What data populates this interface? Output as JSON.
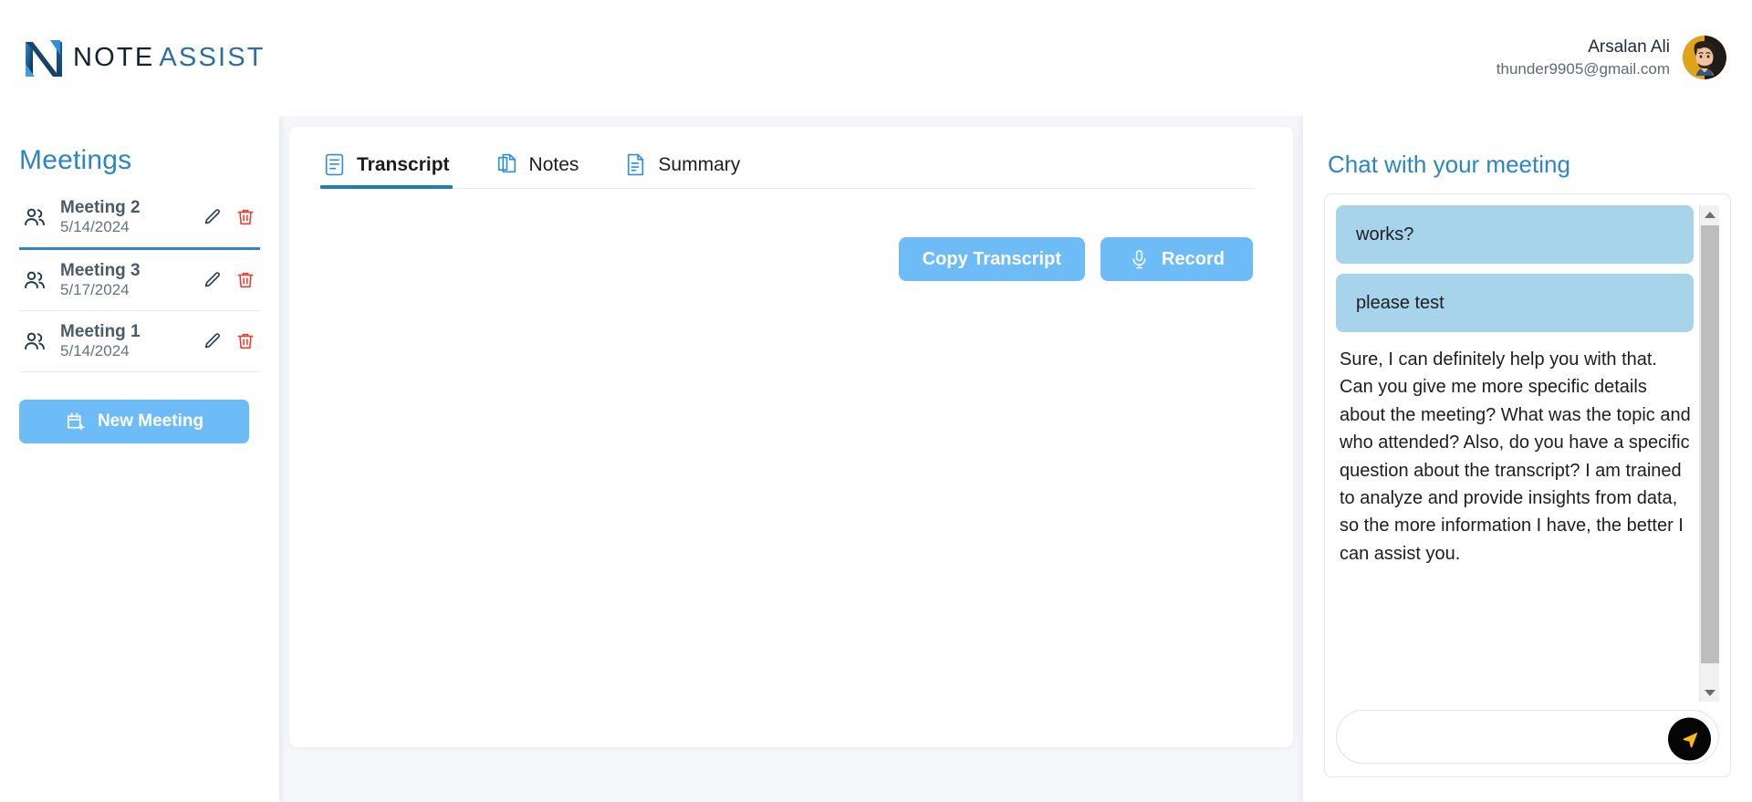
{
  "brand": {
    "name_part1": "NOTE",
    "name_part2": "ASSIST",
    "logo_icon": "n-monogram-icon",
    "accent_blue": "#2b86c4",
    "button_blue": "#6ebcf7",
    "bubble_blue": "#a7d4ea",
    "danger_red": "#ef3b2d",
    "send_yellow": "#fcb813"
  },
  "header": {
    "user_name": "Arsalan Ali",
    "user_email": "thunder9905@gmail.com",
    "avatar_icon": "user-avatar"
  },
  "sidebar": {
    "title": "Meetings",
    "meetings": [
      {
        "name": "Meeting 2",
        "date": "5/14/2024",
        "active": true
      },
      {
        "name": "Meeting 3",
        "date": "5/17/2024",
        "active": false
      },
      {
        "name": "Meeting 1",
        "date": "5/14/2024",
        "active": false
      }
    ],
    "new_meeting_label": "New Meeting"
  },
  "main": {
    "tabs": [
      {
        "label": "Transcript",
        "icon": "transcript-document-icon",
        "active": true
      },
      {
        "label": "Notes",
        "icon": "copy-pages-icon",
        "active": false
      },
      {
        "label": "Summary",
        "icon": "summary-document-icon",
        "active": false
      }
    ],
    "copy_transcript_label": "Copy Transcript",
    "record_label": "Record",
    "transcript_text": ""
  },
  "chat": {
    "title": "Chat with your meeting",
    "messages": [
      {
        "role": "user",
        "text": "works?"
      },
      {
        "role": "user",
        "text": "please test"
      },
      {
        "role": "assistant",
        "text": "Sure, I can definitely help you with that. Can you give me more specific details about the meeting? What was the topic and who attended? Also, do you have a specific question about the transcript? I am trained to analyze and provide insights from data, so the more information I have, the better I can assist you."
      }
    ],
    "input_value": "",
    "input_placeholder": "",
    "send_icon": "send-arrow-icon"
  }
}
